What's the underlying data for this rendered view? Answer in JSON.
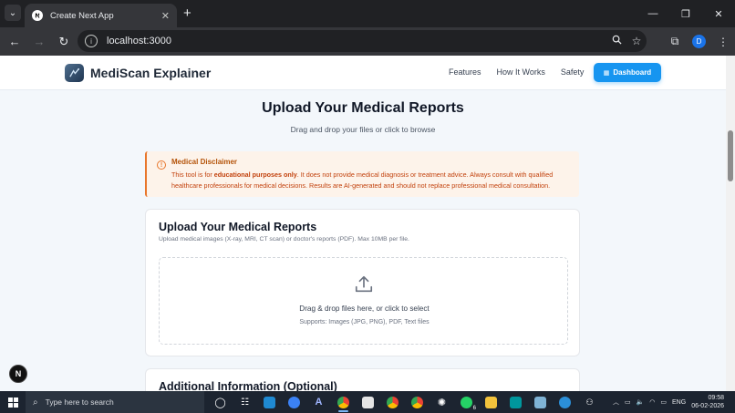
{
  "browser": {
    "tab_title": "Create Next App",
    "url": "localhost:3000",
    "profile_initial": "D"
  },
  "site": {
    "brand": "MediScan Explainer",
    "nav": [
      "Features",
      "How It Works",
      "Safety"
    ],
    "dashboard_label": "Dashboard"
  },
  "hero": {
    "title": "Upload Your Medical Reports",
    "subtitle": "Drag and drop your files or click to browse"
  },
  "disclaimer": {
    "title": "Medical Disclaimer",
    "body_pre": "This tool is for ",
    "body_bold": "educational purposes only",
    "body_post": ". It does not provide medical diagnosis or treatment advice. Always consult with qualified healthcare professionals for medical decisions. Results are AI-generated and should not replace professional medical consultation."
  },
  "upload_card": {
    "title": "Upload Your Medical Reports",
    "subtitle": "Upload medical images (X-ray, MRI, CT scan) or doctor's reports (PDF). Max 10MB per file.",
    "drop_text": "Drag & drop files here, or click to select",
    "supports": "Supports: Images (JPG, PNG), PDF, Text files"
  },
  "additional_card": {
    "title": "Additional Information (Optional)"
  },
  "next_badge": "N",
  "taskbar": {
    "search_placeholder": "Type here to search",
    "language": "ENG",
    "time": "09:58",
    "date": "06-02-2026",
    "whatsapp_badge": "6"
  },
  "colors": {
    "accent": "#1695f0",
    "disclaimer_border": "#e8762b",
    "page_bg": "#f3f7fb"
  }
}
